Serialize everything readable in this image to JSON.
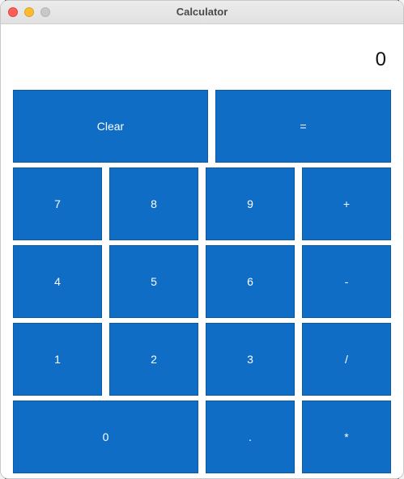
{
  "window": {
    "title": "Calculator"
  },
  "display": {
    "value": "0"
  },
  "buttons": {
    "clear": "Clear",
    "equals": "=",
    "seven": "7",
    "eight": "8",
    "nine": "9",
    "plus": "+",
    "four": "4",
    "five": "5",
    "six": "6",
    "minus": "-",
    "one": "1",
    "two": "2",
    "three": "3",
    "divide": "/",
    "zero": "0",
    "decimal": ".",
    "multiply": "*"
  },
  "colors": {
    "button_background": "#0f6dc6",
    "button_text": "#ffffff"
  }
}
